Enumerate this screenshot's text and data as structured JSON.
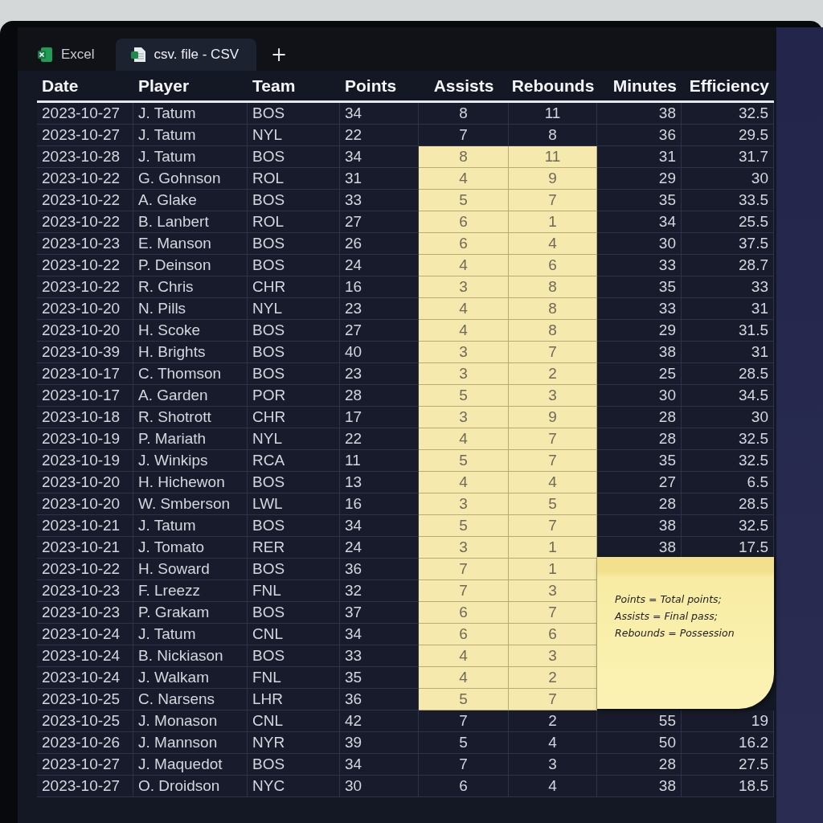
{
  "tabs": [
    {
      "label": "Excel",
      "kind": "excel",
      "selected": false
    },
    {
      "label": "csv. file - CSV",
      "kind": "sheet",
      "selected": true
    }
  ],
  "new_tab_button": "+",
  "table": {
    "columns": [
      "Date",
      "Player",
      "Team",
      "Points",
      "Assists",
      "Rebounds",
      "Minutes",
      "Efficiency"
    ],
    "rows": [
      {
        "date": "2023-10-27",
        "player": "J. Tatum",
        "team": "BOS",
        "points": "34",
        "assists": "8",
        "rebounds": "11",
        "minutes": "38",
        "efficiency": "32.5",
        "highlighted": false
      },
      {
        "date": "2023-10-27",
        "player": "J. Tatum",
        "team": "NYL",
        "points": "22",
        "assists": "7",
        "rebounds": "8",
        "minutes": "36",
        "efficiency": "29.5",
        "highlighted": false
      },
      {
        "date": "2023-10-28",
        "player": "J. Tatum",
        "team": "BOS",
        "points": "34",
        "assists": "8",
        "rebounds": "11",
        "minutes": "31",
        "efficiency": "31.7",
        "highlighted": true
      },
      {
        "date": "2023-10-22",
        "player": "G. Gohnson",
        "team": "ROL",
        "points": "31",
        "assists": "4",
        "rebounds": "9",
        "minutes": "29",
        "efficiency": "30",
        "highlighted": true
      },
      {
        "date": "2023-10-22",
        "player": "A. Glake",
        "team": "BOS",
        "points": "33",
        "assists": "5",
        "rebounds": "7",
        "minutes": "35",
        "efficiency": "33.5",
        "highlighted": true
      },
      {
        "date": "2023-10-22",
        "player": "B. Lanbert",
        "team": "ROL",
        "points": "27",
        "assists": "6",
        "rebounds": "1",
        "minutes": "34",
        "efficiency": "25.5",
        "highlighted": true
      },
      {
        "date": "2023-10-23",
        "player": "E. Manson",
        "team": "BOS",
        "points": "26",
        "assists": "6",
        "rebounds": "4",
        "minutes": "30",
        "efficiency": "37.5",
        "highlighted": true
      },
      {
        "date": "2023-10-22",
        "player": "P. Deinson",
        "team": "BOS",
        "points": "24",
        "assists": "4",
        "rebounds": "6",
        "minutes": "33",
        "efficiency": "28.7",
        "highlighted": true
      },
      {
        "date": "2023-10-22",
        "player": "R. Chris",
        "team": "CHR",
        "points": "16",
        "assists": "3",
        "rebounds": "8",
        "minutes": "35",
        "efficiency": "33",
        "highlighted": true
      },
      {
        "date": "2023-10-20",
        "player": "N. Pills",
        "team": "NYL",
        "points": "23",
        "assists": "4",
        "rebounds": "8",
        "minutes": "33",
        "efficiency": "31",
        "highlighted": true
      },
      {
        "date": "2023-10-20",
        "player": "H. Scoke",
        "team": "BOS",
        "points": "27",
        "assists": "4",
        "rebounds": "8",
        "minutes": "29",
        "efficiency": "31.5",
        "highlighted": true
      },
      {
        "date": "2023-10-39",
        "player": "H. Brights",
        "team": "BOS",
        "points": "40",
        "assists": "3",
        "rebounds": "7",
        "minutes": "38",
        "efficiency": "31",
        "highlighted": true
      },
      {
        "date": "2023-10-17",
        "player": "C. Thomson",
        "team": "BOS",
        "points": "23",
        "assists": "3",
        "rebounds": "2",
        "minutes": "25",
        "efficiency": "28.5",
        "highlighted": true
      },
      {
        "date": "2023-10-17",
        "player": "A. Garden",
        "team": "POR",
        "points": "28",
        "assists": "5",
        "rebounds": "3",
        "minutes": "30",
        "efficiency": "34.5",
        "highlighted": true
      },
      {
        "date": "2023-10-18",
        "player": "R. Shotrott",
        "team": "CHR",
        "points": "17",
        "assists": "3",
        "rebounds": "9",
        "minutes": "28",
        "efficiency": "30",
        "highlighted": true
      },
      {
        "date": "2023-10-19",
        "player": "P. Mariath",
        "team": "NYL",
        "points": "22",
        "assists": "4",
        "rebounds": "7",
        "minutes": "28",
        "efficiency": "32.5",
        "highlighted": true
      },
      {
        "date": "2023-10-19",
        "player": "J. Winkips",
        "team": "RCA",
        "points": "11",
        "assists": "5",
        "rebounds": "7",
        "minutes": "35",
        "efficiency": "32.5",
        "highlighted": true
      },
      {
        "date": "2023-10-20",
        "player": "H. Hichewon",
        "team": "BOS",
        "points": "13",
        "assists": "4",
        "rebounds": "4",
        "minutes": "27",
        "efficiency": "6.5",
        "highlighted": true
      },
      {
        "date": "2023-10-20",
        "player": "W. Smberson",
        "team": "LWL",
        "points": "16",
        "assists": "3",
        "rebounds": "5",
        "minutes": "28",
        "efficiency": "28.5",
        "highlighted": true
      },
      {
        "date": "2023-10-21",
        "player": "J. Tatum",
        "team": "BOS",
        "points": "34",
        "assists": "5",
        "rebounds": "7",
        "minutes": "38",
        "efficiency": "32.5",
        "highlighted": true
      },
      {
        "date": "2023-10-21",
        "player": "J. Tomato",
        "team": "RER",
        "points": "24",
        "assists": "3",
        "rebounds": "1",
        "minutes": "38",
        "efficiency": "17.5",
        "highlighted": true
      },
      {
        "date": "2023-10-22",
        "player": "H. Soward",
        "team": "BOS",
        "points": "36",
        "assists": "7",
        "rebounds": "1",
        "highlighted": true
      },
      {
        "date": "2023-10-23",
        "player": "F. Lreezz",
        "team": "FNL",
        "points": "32",
        "assists": "7",
        "rebounds": "3",
        "highlighted": true
      },
      {
        "date": "2023-10-23",
        "player": "P. Grakam",
        "team": "BOS",
        "points": "37",
        "assists": "6",
        "rebounds": "7",
        "highlighted": true
      },
      {
        "date": "2023-10-24",
        "player": "J. Tatum",
        "team": "CNL",
        "points": "34",
        "assists": "6",
        "rebounds": "6",
        "highlighted": true
      },
      {
        "date": "2023-10-24",
        "player": "B. Nickiason",
        "team": "BOS",
        "points": "33",
        "assists": "4",
        "rebounds": "3",
        "highlighted": true
      },
      {
        "date": "2023-10-24",
        "player": "J. Walkam",
        "team": "FNL",
        "points": "35",
        "assists": "4",
        "rebounds": "2",
        "highlighted": true
      },
      {
        "date": "2023-10-25",
        "player": "C. Narsens",
        "team": "LHR",
        "points": "36",
        "assists": "5",
        "rebounds": "7",
        "highlighted": true
      },
      {
        "date": "2023-10-25",
        "player": "J. Monason",
        "team": "CNL",
        "points": "42",
        "assists": "7",
        "rebounds": "2",
        "minutes": "55",
        "efficiency": "19",
        "highlighted": false
      },
      {
        "date": "2023-10-26",
        "player": "J. Mannson",
        "team": "NYR",
        "points": "39",
        "assists": "5",
        "rebounds": "4",
        "minutes": "50",
        "efficiency": "16.2",
        "highlighted": false
      },
      {
        "date": "2023-10-27",
        "player": "J. Maquedot",
        "team": "BOS",
        "points": "34",
        "assists": "7",
        "rebounds": "3",
        "minutes": "28",
        "efficiency": "27.5",
        "highlighted": false
      },
      {
        "date": "2023-10-27",
        "player": "O. Droidson",
        "team": "NYC",
        "points": "30",
        "assists": "6",
        "rebounds": "4",
        "minutes": "38",
        "efficiency": "18.5",
        "highlighted": false
      }
    ]
  },
  "sticky_note": {
    "lines": [
      "Points = Total points;",
      "Assists = Final pass;",
      "Rebounds = Possession"
    ]
  }
}
